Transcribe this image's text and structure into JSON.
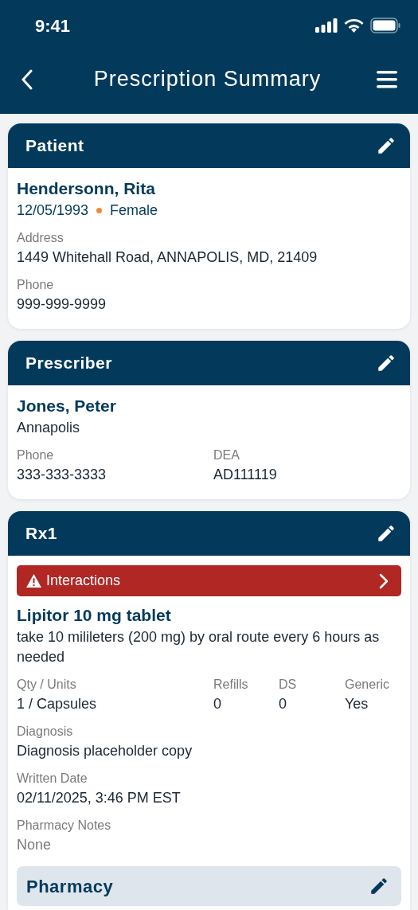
{
  "status_bar": {
    "time": "9:41"
  },
  "nav": {
    "title": "Prescription Summary"
  },
  "cards": [
    {
      "title": "Patient",
      "blocks": [
        {
          "kind": "name",
          "text": "Hendersonn, Rita"
        },
        {
          "kind": "meta",
          "parts": [
            "12/05/1993",
            "Female"
          ]
        },
        {
          "kind": "stack_fields",
          "items": [
            {
              "label": "Address",
              "value": "1449 Whitehall Road, ANNAPOLIS, MD, 21409",
              "muted": false
            },
            {
              "label": "Phone",
              "value": "999-999-9999",
              "muted": false
            }
          ]
        }
      ]
    },
    {
      "title": "Prescriber",
      "blocks": [
        {
          "kind": "name",
          "text": "Jones, Peter"
        },
        {
          "kind": "line",
          "text": "Annapolis"
        },
        {
          "kind": "pair_fields",
          "items": [
            {
              "label": "Phone",
              "value": "333-333-3333",
              "muted": false
            },
            {
              "label": "DEA",
              "value": "AD111119",
              "muted": false
            }
          ]
        }
      ]
    },
    {
      "title": "Rx1",
      "blocks": [
        {
          "kind": "alert",
          "text": "Interactions"
        },
        {
          "kind": "name",
          "text": "Lipitor 10 mg tablet"
        },
        {
          "kind": "line",
          "text": "take 10 milileters (200 mg) by oral route every 6 hours as needed"
        },
        {
          "kind": "quad_fields",
          "items": [
            {
              "label": "Qty / Units",
              "value": "1 / Capsules",
              "muted": false
            },
            {
              "label": "Refills",
              "value": "0",
              "muted": false
            },
            {
              "label": "DS",
              "value": "0",
              "muted": false
            },
            {
              "label": "Generic",
              "value": "Yes",
              "muted": false
            }
          ]
        },
        {
          "kind": "stack_fields",
          "items": [
            {
              "label": "Diagnosis",
              "value": "Diagnosis placeholder copy",
              "muted": false
            },
            {
              "label": "Written Date",
              "value": "02/11/2025, 3:46 PM EST",
              "muted": false
            },
            {
              "label": "Pharmacy Notes",
              "value": "None",
              "muted": true
            }
          ]
        },
        {
          "kind": "section",
          "text": "Pharmacy"
        }
      ]
    }
  ]
}
